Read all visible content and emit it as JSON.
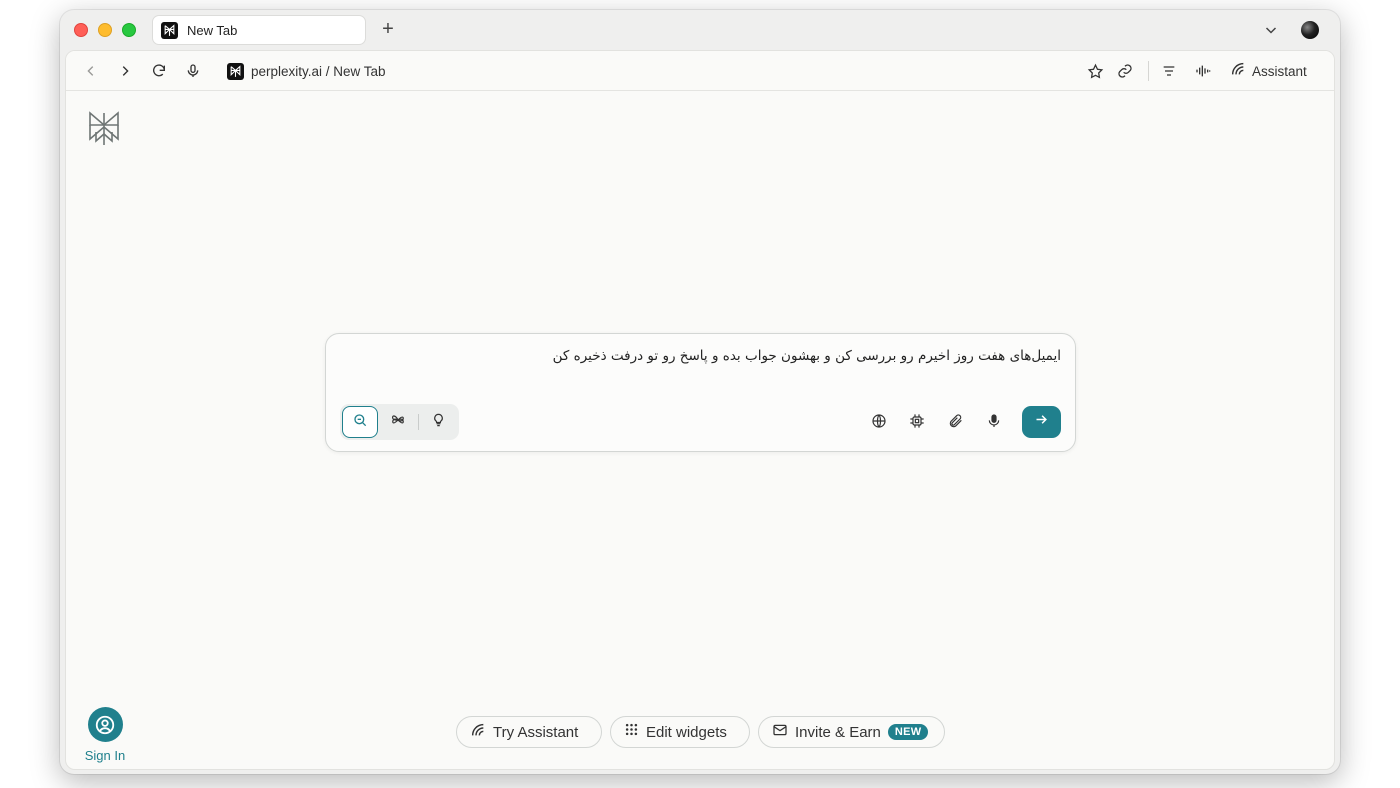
{
  "browser": {
    "tab": {
      "title": "New Tab"
    },
    "address": {
      "text": "perplexity.ai / New Tab"
    },
    "assistant_label": "Assistant"
  },
  "search": {
    "query": "ایمیل‌های هفت روز اخیرم رو بررسی کن و بهشون جواب بده و پاسخ رو تو درفت ذخیره کن",
    "modes": [
      "search",
      "research",
      "labs"
    ],
    "active_mode": "search"
  },
  "signin": {
    "label": "Sign In"
  },
  "bottom_actions": {
    "try_assistant": "Try Assistant",
    "edit_widgets": "Edit widgets",
    "invite_earn": "Invite & Earn",
    "invite_badge": "NEW"
  },
  "colors": {
    "accent": "#20808d",
    "background": "#fafaf8"
  },
  "icons": [
    "search-icon",
    "research-icon",
    "lightbulb-icon",
    "globe-icon",
    "cpu-icon",
    "paperclip-icon",
    "mic-icon",
    "arrow-right-icon"
  ]
}
